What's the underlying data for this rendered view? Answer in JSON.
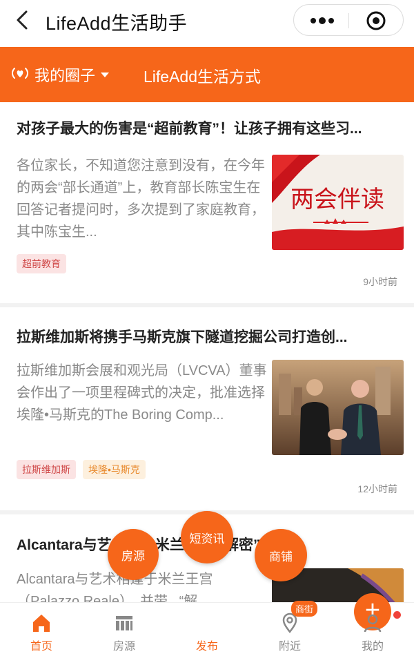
{
  "navbar": {
    "title": "LifeAdd生活助手"
  },
  "header": {
    "circle_label": "我的圈子",
    "lifestyle_label": "LifeAdd生活方式"
  },
  "articles": [
    {
      "title": "对孩子最大的伤害是“超前教育”！让孩子拥有这些习...",
      "excerpt": "各位家长，不知道您注意到没有，在今年的两会“部长通道”上，教育部长陈宝生在回答记者提问时，多次提到了家庭教育，其中陈宝生...",
      "thumb_text": "两会伴读",
      "tags": [
        "超前教育"
      ],
      "time": "9小时前"
    },
    {
      "title": "拉斯维加斯将携手马斯克旗下隧道挖掘公司打造创...",
      "excerpt": "拉斯维加斯会展和观光局（LVCVA）董事会作出了一项里程碑式的决定，批准选择埃隆•马斯克的The Boring Comp...",
      "tags": [
        "拉斯维加斯",
        "埃隆•马斯克"
      ],
      "time": "12小时前"
    },
    {
      "title": "Alcantara与艺术相逢米兰 开启“解密”之旅",
      "excerpt": "Alcantara与艺术相逢于米兰王宫（Palazzo Reale），并带...“解"
    }
  ],
  "fabs": {
    "house": "房源",
    "news": "短资讯",
    "shop": "商铺"
  },
  "tabbar": {
    "home": "首页",
    "house": "房源",
    "publish": "发布",
    "nearby": "附近",
    "nearby_badge": "商街",
    "mine": "我的"
  },
  "colors": {
    "accent": "#f6661a",
    "tag_red": "#d04a4a",
    "tag_orange": "#e8892c",
    "dot_red": "#f0433a"
  }
}
